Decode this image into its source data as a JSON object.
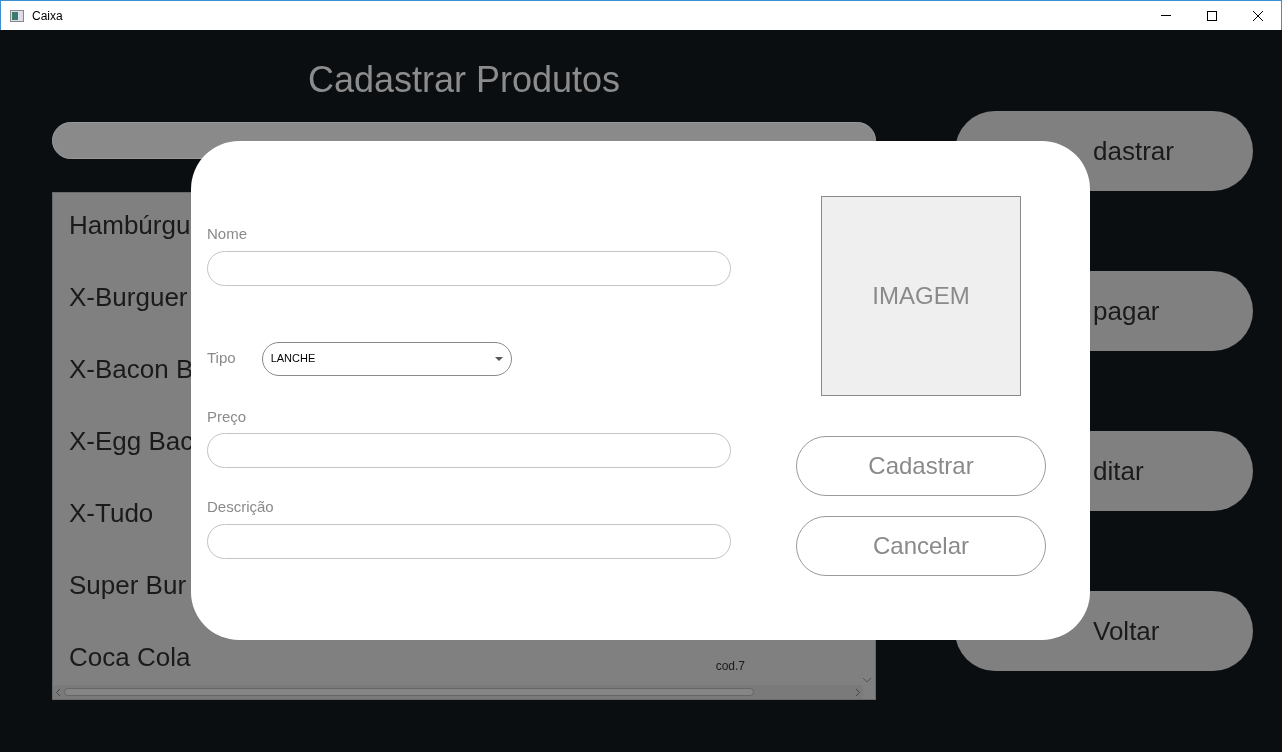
{
  "window": {
    "title": "Caixa"
  },
  "heading": "Cadastrar Produtos",
  "products": [
    {
      "name": "Hambúrgu"
    },
    {
      "name": "X-Burguer"
    },
    {
      "name": "X-Bacon B"
    },
    {
      "name": "X-Egg Bac"
    },
    {
      "name": "X-Tudo"
    },
    {
      "name": "Super Bur"
    },
    {
      "name": "Coca Cola",
      "code": "cod.7"
    }
  ],
  "side_buttons": [
    "dastrar",
    "pagar",
    "ditar",
    "Voltar"
  ],
  "dialog": {
    "fields": [
      {
        "kind": "text",
        "label": "Nome"
      },
      {
        "kind": "select",
        "label": "Tipo",
        "value": "LANCHE"
      },
      {
        "kind": "text",
        "label": "Preço"
      },
      {
        "kind": "text",
        "label": "Descrição"
      }
    ],
    "image_label": "IMAGEM",
    "buttons": [
      "Cadastrar",
      "Cancelar"
    ]
  }
}
